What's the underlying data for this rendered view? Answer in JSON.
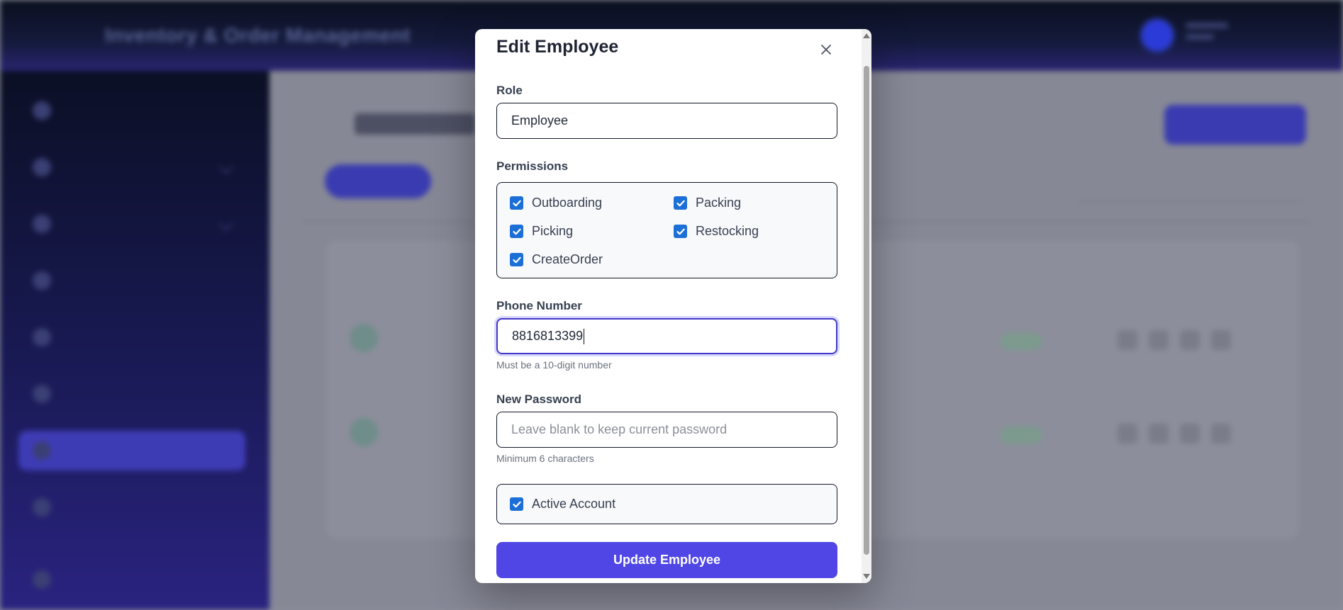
{
  "background_app": {
    "title": "Inventory & Order Management"
  },
  "modal": {
    "title": "Edit Employee",
    "close_icon": "close-icon",
    "role": {
      "label": "Role",
      "value": "Employee"
    },
    "permissions": {
      "label": "Permissions",
      "items": [
        {
          "label": "Outboarding",
          "checked": true
        },
        {
          "label": "Packing",
          "checked": true
        },
        {
          "label": "Picking",
          "checked": true
        },
        {
          "label": "Restocking",
          "checked": true
        },
        {
          "label": "CreateOrder",
          "checked": true
        }
      ]
    },
    "phone": {
      "label": "Phone Number",
      "value": "8816813399",
      "hint": "Must be a 10-digit number"
    },
    "password": {
      "label": "New Password",
      "placeholder": "Leave blank to keep current password",
      "hint": "Minimum 6 characters"
    },
    "active_account": {
      "label": "Active Account",
      "checked": true
    },
    "submit_label": "Update Employee"
  },
  "colors": {
    "primary": "#4f46e5",
    "checkbox": "#1d6fd8",
    "focus_border": "#4338ca"
  }
}
